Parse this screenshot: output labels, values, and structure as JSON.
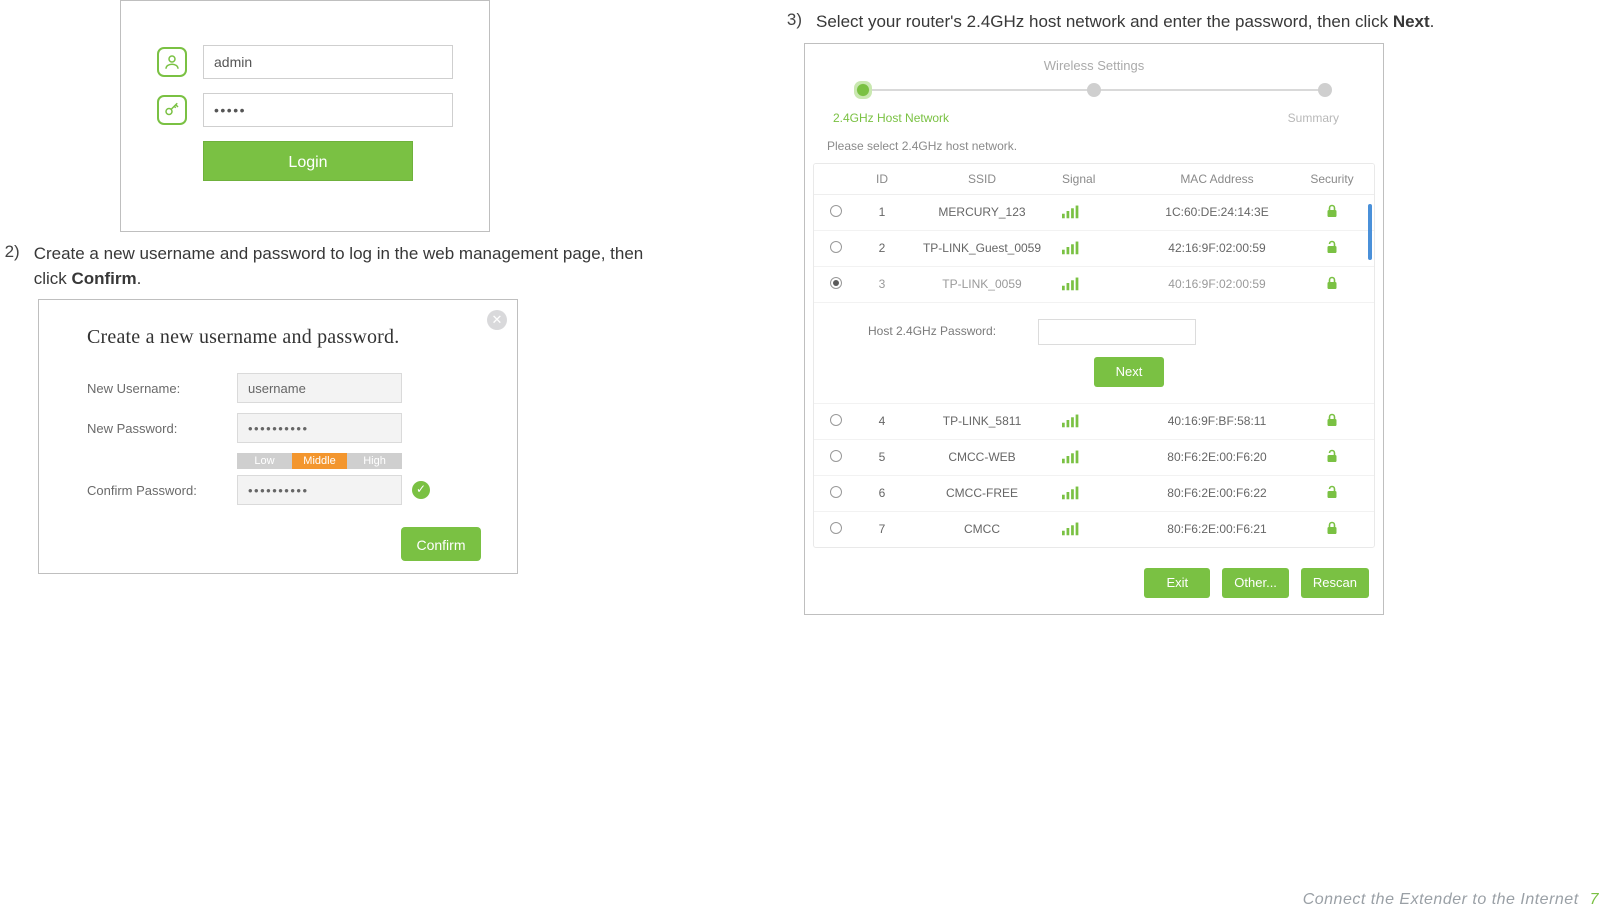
{
  "login": {
    "username_value": "admin",
    "password_value": "•••••",
    "login_label": "Login"
  },
  "step2": {
    "number": "2)",
    "text_pre": "Create a new username and password to log in the web management page, then click ",
    "bold": "Confirm",
    "text_post": "."
  },
  "create": {
    "title": "Create a new username and password.",
    "new_username_label": "New Username:",
    "new_username_value": "username",
    "new_password_label": "New Password:",
    "new_password_value": "••••••••••",
    "strength_low": "Low",
    "strength_mid": "Middle",
    "strength_high": "High",
    "confirm_password_label": "Confirm Password:",
    "confirm_password_value": "••••••••••",
    "confirm_button": "Confirm"
  },
  "step3": {
    "number": "3)",
    "text_pre": "Select your router's 2.4GHz host network and enter the password, then click ",
    "bold": "Next",
    "text_post": "."
  },
  "wifi": {
    "header_title": "Wireless Settings",
    "progress_host": "2.4GHz Host Network",
    "progress_summary": "Summary",
    "instruction": "Please select 2.4GHz host network.",
    "columns": {
      "id": "ID",
      "ssid": "SSID",
      "signal": "Signal",
      "mac": "MAC Address",
      "security": "Security"
    },
    "host_pw_label": "Host 2.4GHz Password:",
    "next_label": "Next",
    "networks": [
      {
        "id": "1",
        "ssid": "MERCURY_123",
        "mac": "1C:60:DE:24:14:3E",
        "lock": "closed",
        "selected": false
      },
      {
        "id": "2",
        "ssid": "TP-LINK_Guest_0059",
        "mac": "42:16:9F:02:00:59",
        "lock": "open",
        "selected": false
      },
      {
        "id": "3",
        "ssid": "TP-LINK_0059",
        "mac": "40:16:9F:02:00:59",
        "lock": "closed",
        "selected": true
      },
      {
        "id": "4",
        "ssid": "TP-LINK_5811",
        "mac": "40:16:9F:BF:58:11",
        "lock": "closed",
        "selected": false
      },
      {
        "id": "5",
        "ssid": "CMCC-WEB",
        "mac": "80:F6:2E:00:F6:20",
        "lock": "open",
        "selected": false
      },
      {
        "id": "6",
        "ssid": "CMCC-FREE",
        "mac": "80:F6:2E:00:F6:22",
        "lock": "open",
        "selected": false
      },
      {
        "id": "7",
        "ssid": "CMCC",
        "mac": "80:F6:2E:00:F6:21",
        "lock": "closed",
        "selected": false
      }
    ],
    "exit_label": "Exit",
    "other_label": "Other...",
    "rescan_label": "Rescan"
  },
  "footer": {
    "text": "Connect  the  Extender  to  the  Internet",
    "page_no": "7"
  }
}
